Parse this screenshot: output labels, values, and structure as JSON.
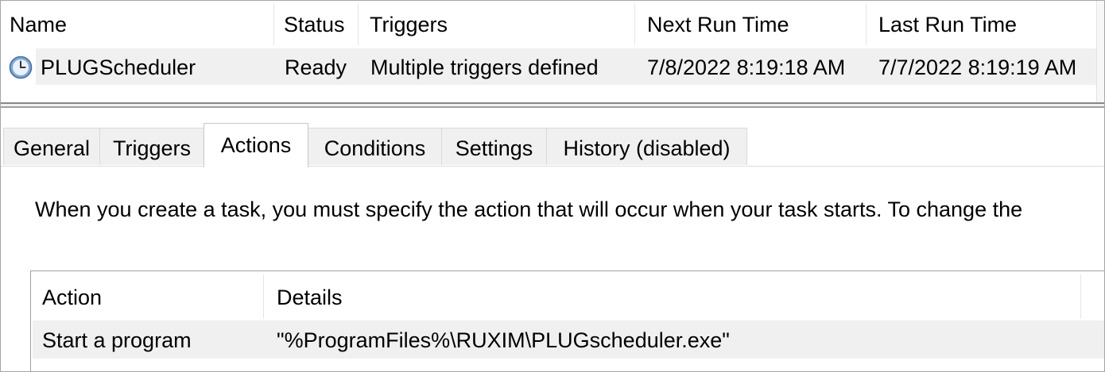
{
  "task_list": {
    "columns": {
      "name": "Name",
      "status": "Status",
      "triggers": "Triggers",
      "next_run": "Next Run Time",
      "last_run": "Last Run Time"
    },
    "rows": [
      {
        "icon": "clock-icon",
        "name": "PLUGScheduler",
        "status": "Ready",
        "triggers": "Multiple triggers defined",
        "next_run": "7/8/2022 8:19:18 AM",
        "last_run": "7/7/2022 8:19:19 AM"
      }
    ]
  },
  "tabs": [
    {
      "label": "General",
      "active": false
    },
    {
      "label": "Triggers",
      "active": false
    },
    {
      "label": "Actions",
      "active": true
    },
    {
      "label": "Conditions",
      "active": false
    },
    {
      "label": "Settings",
      "active": false
    },
    {
      "label": "History (disabled)",
      "active": false
    }
  ],
  "actions_tab": {
    "description": "When you create a task, you must specify the action that will occur when your task starts.  To change the",
    "table": {
      "columns": {
        "action": "Action",
        "details": "Details"
      },
      "rows": [
        {
          "action": "Start a program",
          "details": "\"%ProgramFiles%\\RUXIM\\PLUGscheduler.exe\""
        }
      ]
    }
  },
  "colors": {
    "selected_row": "#f0f0f0",
    "tab_inactive": "#f0f0f0",
    "border": "#a0a0a0",
    "clock_face": "#7fa8d6"
  }
}
